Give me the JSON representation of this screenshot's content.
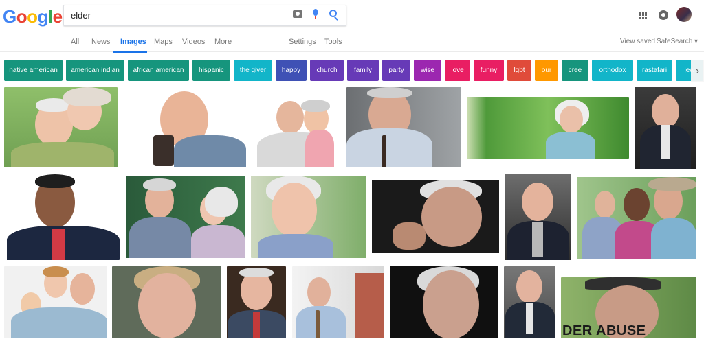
{
  "logo": {
    "letters": [
      "G",
      "o",
      "o",
      "g",
      "l",
      "e"
    ],
    "colors": [
      "#4285f4",
      "#ea4335",
      "#fbbc05",
      "#4285f4",
      "#34a853",
      "#ea4335"
    ]
  },
  "search": {
    "query": "elder",
    "icons": [
      "camera-icon",
      "mic-icon",
      "search-icon"
    ]
  },
  "header_icons": [
    "apps-icon",
    "notifications-icon",
    "avatar"
  ],
  "tabs": {
    "items": [
      "All",
      "News",
      "Images",
      "Maps",
      "Videos",
      "More"
    ],
    "active": "Images",
    "settings": "Settings",
    "tools": "Tools"
  },
  "right_links": {
    "view_saved": "View saved",
    "safesearch": "SafeSearch ▾"
  },
  "chips": [
    {
      "label": "native american",
      "color": "#16957d"
    },
    {
      "label": "american indian",
      "color": "#16957d"
    },
    {
      "label": "african american",
      "color": "#16957d"
    },
    {
      "label": "hispanic",
      "color": "#16957d"
    },
    {
      "label": "the giver",
      "color": "#12b5c9"
    },
    {
      "label": "happy",
      "color": "#3f51b5"
    },
    {
      "label": "church",
      "color": "#673ab7"
    },
    {
      "label": "family",
      "color": "#673ab7"
    },
    {
      "label": "party",
      "color": "#673ab7"
    },
    {
      "label": "wise",
      "color": "#9c27b0"
    },
    {
      "label": "love",
      "color": "#e91e63"
    },
    {
      "label": "funny",
      "color": "#e91e63"
    },
    {
      "label": "lgbt",
      "color": "#e04b3a"
    },
    {
      "label": "our",
      "color": "#ff9800"
    },
    {
      "label": "cree",
      "color": "#16957d"
    },
    {
      "label": "orthodox",
      "color": "#12b5c9"
    },
    {
      "label": "rastafari",
      "color": "#12b5c9"
    },
    {
      "label": "jew",
      "color": "#12b5c9"
    }
  ],
  "image_caption": "DER ABUSE"
}
